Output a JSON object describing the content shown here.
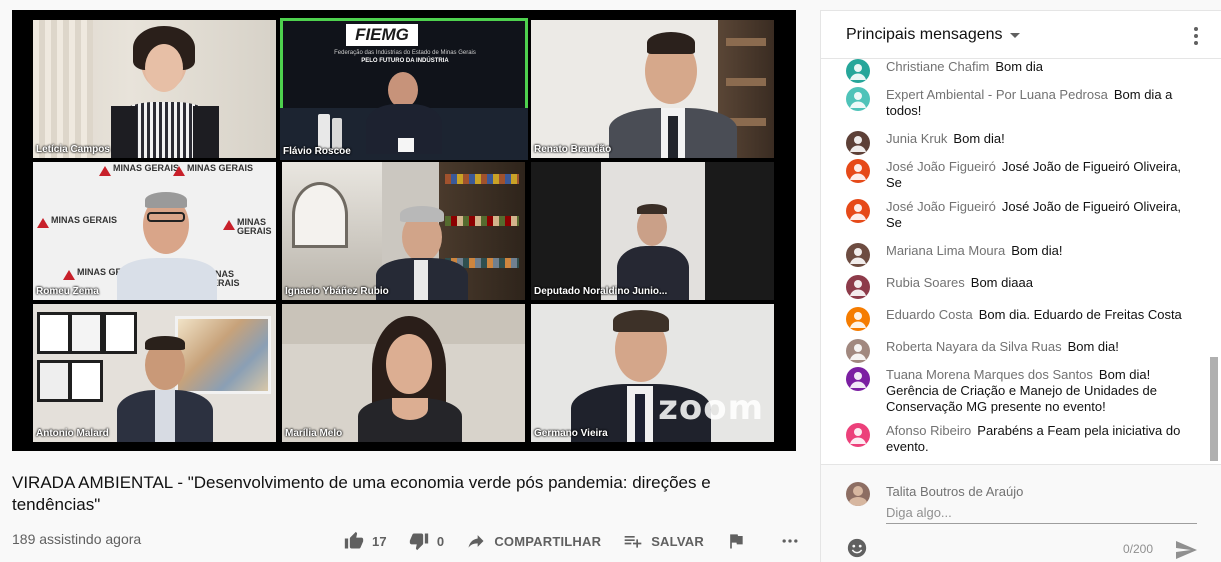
{
  "video": {
    "participants": [
      {
        "name": "Letícia Campos"
      },
      {
        "name": "Flávio Roscoe"
      },
      {
        "name": "Renato Brandão"
      },
      {
        "name": "Romeu Zema"
      },
      {
        "name": "Ignacio Ybáñez Rubio"
      },
      {
        "name": "Deputado Noraldino Junio..."
      },
      {
        "name": "Antonio Malard"
      },
      {
        "name": "Marília Melo"
      },
      {
        "name": "Germano Vieira"
      }
    ],
    "fiemg_sign": "FIEMG",
    "fiemg_sub": "Federação das Indústrias do Estado de Minas Gerais",
    "fiemg_sub2": "PELO FUTURO DA INDÚSTRIA",
    "mg_logo": "MINAS GERAIS",
    "zoom_logo": "zoom"
  },
  "title": "VIRADA AMBIENTAL - \"Desenvolvimento de uma economia verde pós pandemia: direções e tendências\"",
  "viewers": "189 assistindo agora",
  "actions": {
    "like_count": "17",
    "dislike_count": "0",
    "share_label": "COMPARTILHAR",
    "save_label": "SALVAR"
  },
  "chat": {
    "header": "Principais mensagens",
    "messages": [
      {
        "author": "Christiane Chafim",
        "text": "Bom dia",
        "avatar_color": "#26a69a"
      },
      {
        "author": "Expert Ambiental - Por Luana Pedrosa",
        "text": "Bom dia a todos!",
        "avatar_color": "#4fc3b9"
      },
      {
        "author": "Junia Kruk",
        "text": "Bom dia!",
        "avatar_color": "#5d4037"
      },
      {
        "author": "José João Figueiró",
        "text": "José João de Figueiró Oliveira, Se",
        "avatar_color": "#e64a19"
      },
      {
        "author": "José João Figueiró",
        "text": "José João de Figueiró Oliveira, Se",
        "avatar_color": "#e64a19"
      },
      {
        "author": "Mariana Lima Moura",
        "text": "Bom dia!",
        "avatar_color": "#6d4c41"
      },
      {
        "author": "Rubia Soares",
        "text": "Bom diaaa",
        "avatar_color": "#8d3b4a"
      },
      {
        "author": "Eduardo Costa",
        "text": "Bom dia. Eduardo de Freitas Costa",
        "avatar_color": "#f57c00"
      },
      {
        "author": "Roberta Nayara da Silva Ruas",
        "text": "Bom dia!",
        "avatar_color": "#a1887f"
      },
      {
        "author": "Tuana Morena Marques dos Santos",
        "text": "Bom dia! Gerência de Criação e Manejo de Unidades de Conservação MG presente no evento!",
        "avatar_color": "#7b1fa2"
      },
      {
        "author": "Afonso Ribeiro",
        "text": "Parabéns a Feam pela iniciativa do evento.",
        "avatar_color": "#ec407a"
      }
    ],
    "current_user": "Talita Boutros de Araújo",
    "placeholder": "Diga algo...",
    "char_count": "0/200"
  }
}
